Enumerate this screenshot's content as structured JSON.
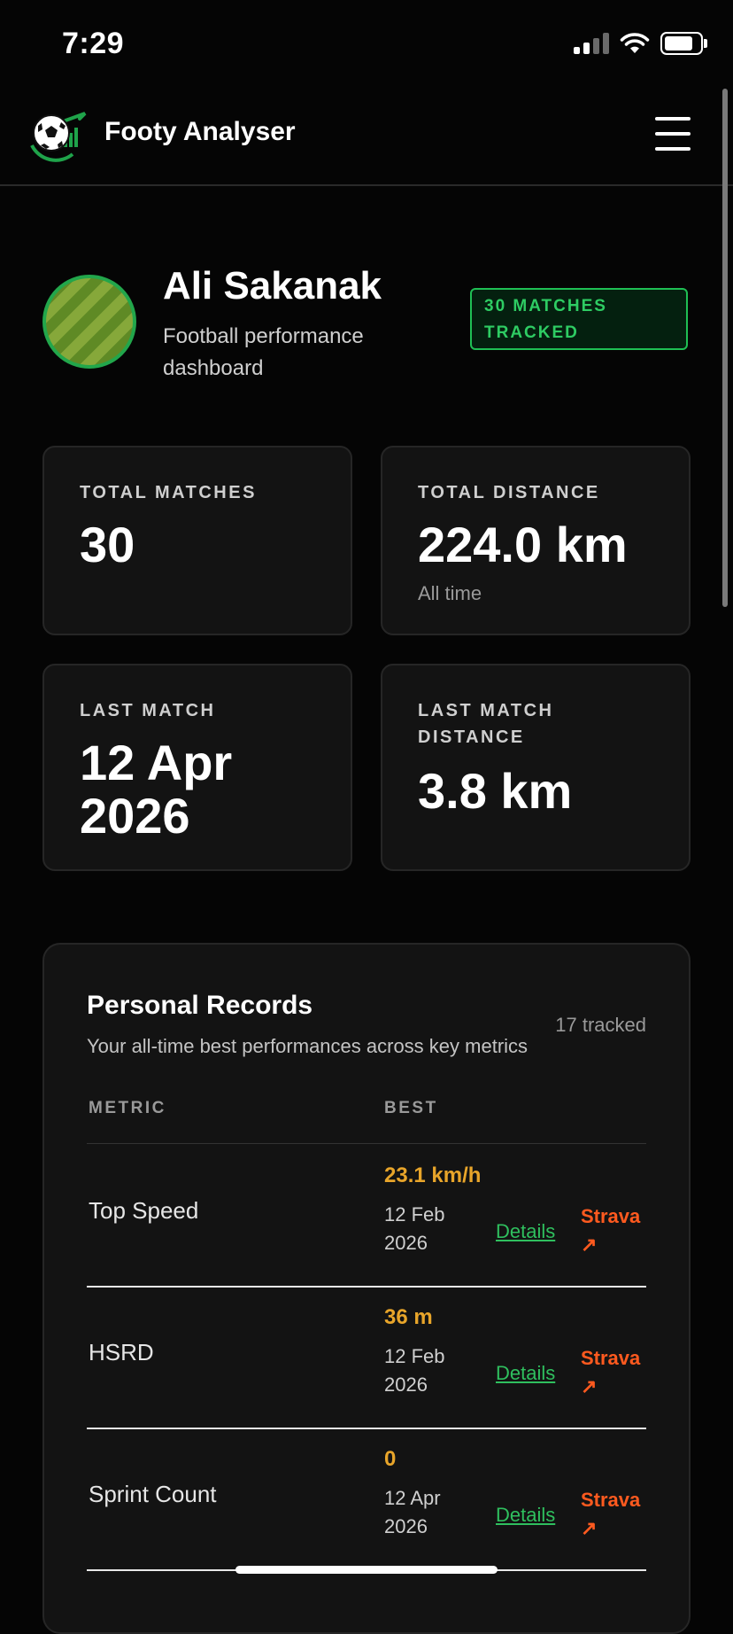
{
  "status_bar": {
    "time": "7:29"
  },
  "app": {
    "title": "Footy Analyser"
  },
  "profile": {
    "name": "Ali Sakanak",
    "subtitle": "Football performance dashboard",
    "badge": "30 MATCHES TRACKED"
  },
  "stats": {
    "total_matches": {
      "label": "TOTAL MATCHES",
      "value": "30"
    },
    "total_distance": {
      "label": "TOTAL DISTANCE",
      "value": "224.0 km",
      "note": "All time"
    },
    "last_match": {
      "label": "LAST MATCH",
      "value": "12 Apr 2026"
    },
    "last_match_distance": {
      "label": "LAST MATCH DISTANCE",
      "value": "3.8 km"
    }
  },
  "records": {
    "title": "Personal Records",
    "subtitle": "Your all-time best performances across key metrics",
    "count": "17 tracked",
    "columns": [
      "METRIC",
      "BEST"
    ],
    "rows": [
      {
        "metric": "Top Speed",
        "best": "23.1 km/h",
        "date": "12 Feb 2026",
        "details": "Details",
        "strava": "Strava ↗"
      },
      {
        "metric": "HSRD",
        "best": "36 m",
        "date": "12 Feb 2026",
        "details": "Details",
        "strava": "Strava ↗"
      },
      {
        "metric": "Sprint Count",
        "best": "0",
        "date": "12 Apr 2026",
        "details": "Details",
        "strava": "Strava ↗"
      }
    ]
  },
  "colors": {
    "accent_green": "#2ecc63",
    "best_value": "#e8a52a",
    "strava": "#ff5a1f",
    "background": "#050505",
    "card": "#131313"
  },
  "icons": {
    "logo": "soccer-ball-logo-icon",
    "menu": "hamburger-menu-icon",
    "signal": "cellular-signal-icon",
    "wifi": "wifi-icon",
    "battery": "battery-icon"
  },
  "battery_level": 0.9
}
